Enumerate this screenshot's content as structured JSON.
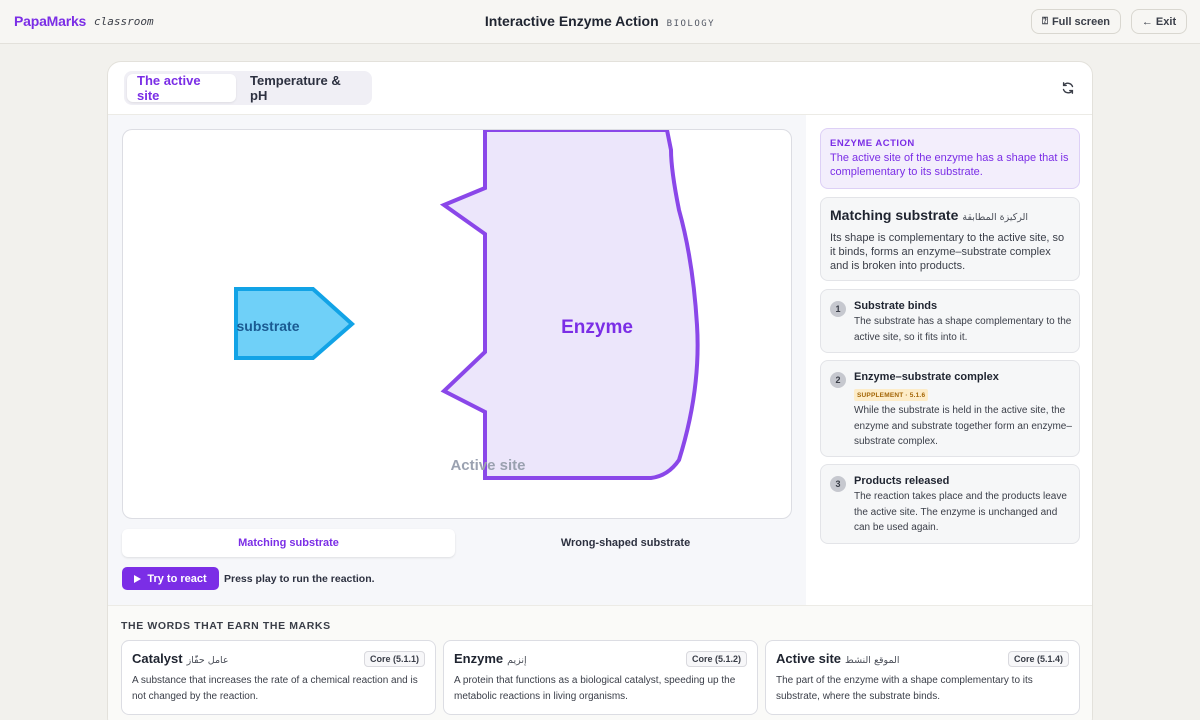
{
  "header": {
    "brand": "PapaMarks",
    "brand_sub": "classroom",
    "title": "Interactive Enzyme Action",
    "subject": "BIOLOGY",
    "fullscreen_label": "Full screen",
    "exit_label": "← Exit"
  },
  "tabs": [
    {
      "label": "The active site",
      "active": true
    },
    {
      "label": "Temperature & pH",
      "active": false
    }
  ],
  "stage": {
    "substrate_label": "substrate",
    "enzyme_label": "Enzyme",
    "active_site_label": "Active site",
    "colors": {
      "enzyme_fill": "#ece6fb",
      "enzyme_stroke": "#8a47e9",
      "substrate_fill": "#6fd0f8",
      "substrate_stroke": "#12a3e6"
    }
  },
  "modes": [
    {
      "label": "Matching substrate",
      "active": true
    },
    {
      "label": "Wrong-shaped substrate",
      "active": false
    }
  ],
  "play": {
    "label": "Try to react",
    "hint": "Press play to run the reaction."
  },
  "side": {
    "aim_label": "ENZYME ACTION",
    "aim_text": "The active site of the enzyme has a shape that is complementary to its substrate.",
    "match_title": "Matching substrate",
    "match_arabic": "الركيزة المطابقة",
    "match_text": "Its shape is complementary to the active site, so it binds, forms an enzyme–substrate complex and is broken into products.",
    "steps": [
      {
        "num": "1",
        "title": "Substrate binds",
        "text": "The substrate has a shape complementary to the active site, so it fits into it."
      },
      {
        "num": "2",
        "title": "Enzyme–substrate complex",
        "badge": "SUPPLEMENT · 5.1.6",
        "text": "While the substrate is held in the active site, the enzyme and substrate together form an enzyme–substrate complex."
      },
      {
        "num": "3",
        "title": "Products released",
        "text": "The reaction takes place and the products leave the active site. The enzyme is unchanged and can be used again."
      }
    ]
  },
  "vocab": {
    "heading": "THE WORDS THAT EARN THE MARKS",
    "cards": [
      {
        "term": "Catalyst",
        "arabic": "عامل حفّاز",
        "code": "Core (5.1.1)",
        "definition": "A substance that increases the rate of a chemical reaction and is not changed by the reaction."
      },
      {
        "term": "Enzyme",
        "arabic": "إنزيم",
        "code": "Core (5.1.2)",
        "definition": "A protein that functions as a biological catalyst, speeding up the metabolic reactions in living organisms."
      },
      {
        "term": "Active site",
        "arabic": "الموقع النشط",
        "code": "Core (5.1.4)",
        "definition": "The part of the enzyme with a shape complementary to its substrate, where the substrate binds."
      }
    ]
  }
}
